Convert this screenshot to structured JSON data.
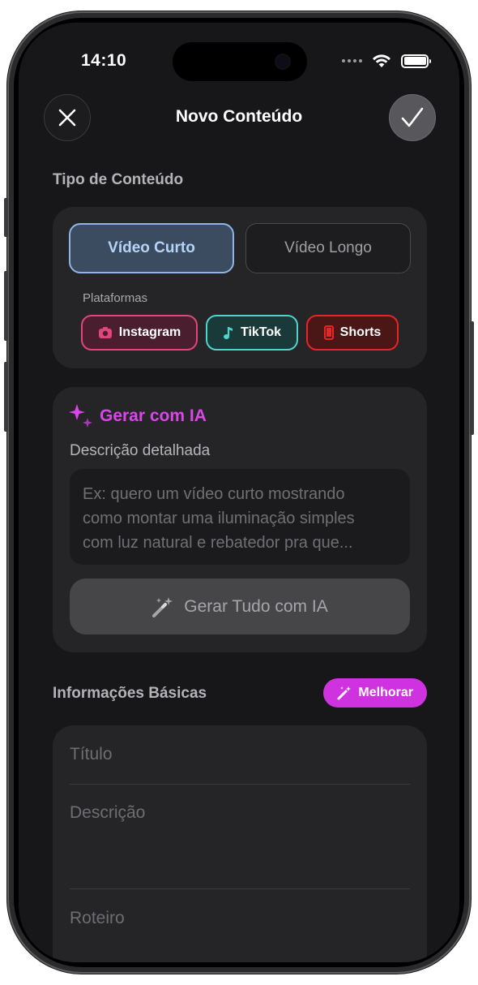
{
  "status_bar": {
    "time": "14:10"
  },
  "header": {
    "title": "Novo Conteúdo"
  },
  "content_type": {
    "section_label": "Tipo de Conteúdo",
    "options": [
      {
        "label": "Vídeo Curto",
        "selected": true
      },
      {
        "label": "Vídeo Longo",
        "selected": false
      }
    ],
    "platforms_label": "Plataformas",
    "platforms": [
      {
        "label": "Instagram",
        "icon": "camera-icon",
        "color": "#e2457c"
      },
      {
        "label": "TikTok",
        "icon": "music-note-icon",
        "color": "#4fd3cc"
      },
      {
        "label": "Shorts",
        "icon": "phone-icon",
        "color": "#e32626"
      }
    ]
  },
  "ai": {
    "title": "Gerar com IA",
    "description_label": "Descrição detalhada",
    "description_placeholder_lines": [
      "Ex: quero um vídeo curto mostrando",
      "como montar uma iluminação simples",
      "com luz natural e rebatedor pra que..."
    ],
    "generate_button": "Gerar Tudo com IA",
    "accent_color": "#d947e8"
  },
  "basic_info": {
    "section_label": "Informações Básicas",
    "improve_button": "Melhorar",
    "fields": {
      "title_placeholder": "Título",
      "description_placeholder": "Descrição",
      "script_placeholder": "Roteiro"
    }
  }
}
